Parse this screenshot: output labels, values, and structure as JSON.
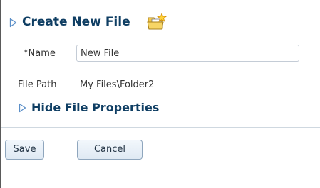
{
  "dialog": {
    "title": "Create New File",
    "title_icon": "new-file-icon",
    "collapse_icon": "disclosure-triangle-icon"
  },
  "form": {
    "name_required_marker": "*",
    "name_label": "Name",
    "name_value": "New File",
    "path_label": "File Path",
    "path_value": "My Files\\Folder2",
    "properties_toggle_label": "Hide File Properties"
  },
  "buttons": {
    "save_label": "Save",
    "cancel_label": "Cancel"
  },
  "colors": {
    "title": "#0f3e63",
    "disclosure_stroke": "#5b8fc8",
    "button_border": "#8fa6bd"
  }
}
